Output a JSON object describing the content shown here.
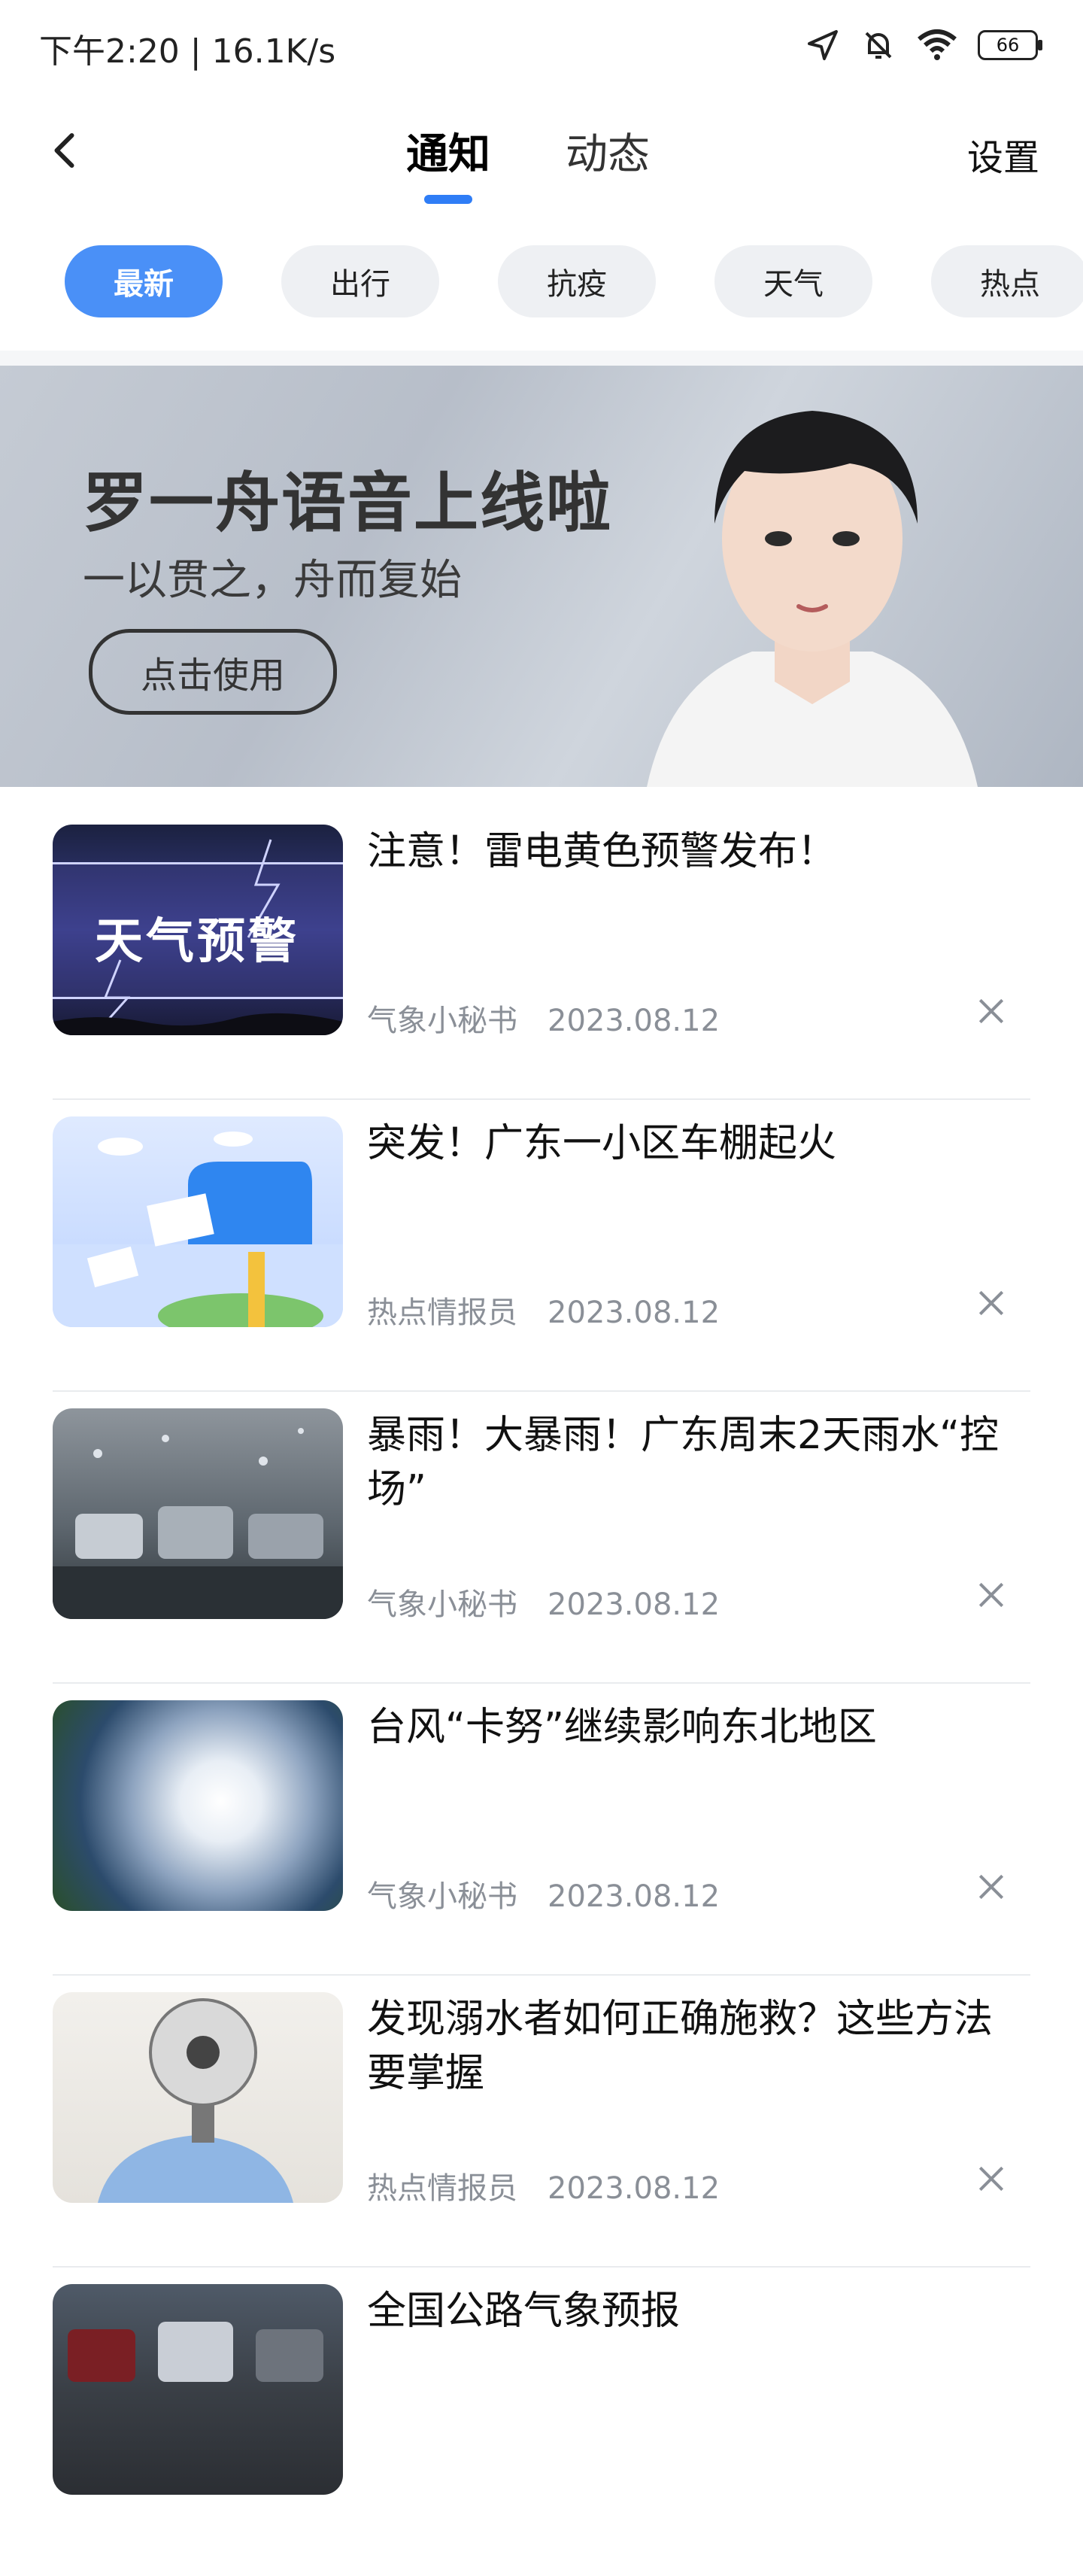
{
  "status_bar": {
    "time_speed": "下午2:20 | 16.1K/s",
    "battery": "66",
    "icons": [
      "location-arrow-icon",
      "bell-muted-icon",
      "wifi-icon",
      "battery-icon"
    ]
  },
  "header": {
    "back_icon": "back-icon",
    "tabs": [
      {
        "label": "通知",
        "active": true
      },
      {
        "label": "动态",
        "active": false
      }
    ],
    "settings_label": "设置",
    "accent": "#2f7df6"
  },
  "chips": [
    {
      "label": "最新",
      "active": true
    },
    {
      "label": "出行",
      "active": false
    },
    {
      "label": "抗疫",
      "active": false
    },
    {
      "label": "天气",
      "active": false
    },
    {
      "label": "热点",
      "active": false
    }
  ],
  "banner": {
    "title": "罗一舟语音上线啦",
    "subtitle": "一以贯之，舟而复始",
    "cta_label": "点击使用"
  },
  "news": [
    {
      "title": "注意！雷电黄色预警发布！",
      "source": "气象小秘书",
      "date": "2023.08.12",
      "thumb_text": "天气预警"
    },
    {
      "title": "突发！广东一小区车棚起火",
      "source": "热点情报员",
      "date": "2023.08.12"
    },
    {
      "title": "暴雨！大暴雨！广东周末2天雨水“控场”",
      "source": "气象小秘书",
      "date": "2023.08.12"
    },
    {
      "title": "台风“卡努”继续影响东北地区",
      "source": "气象小秘书",
      "date": "2023.08.12"
    },
    {
      "title": "发现溺水者如何正确施救？这些方法要掌握",
      "source": "热点情报员",
      "date": "2023.08.12"
    },
    {
      "title": "全国公路气象预报",
      "source": "",
      "date": ""
    }
  ]
}
